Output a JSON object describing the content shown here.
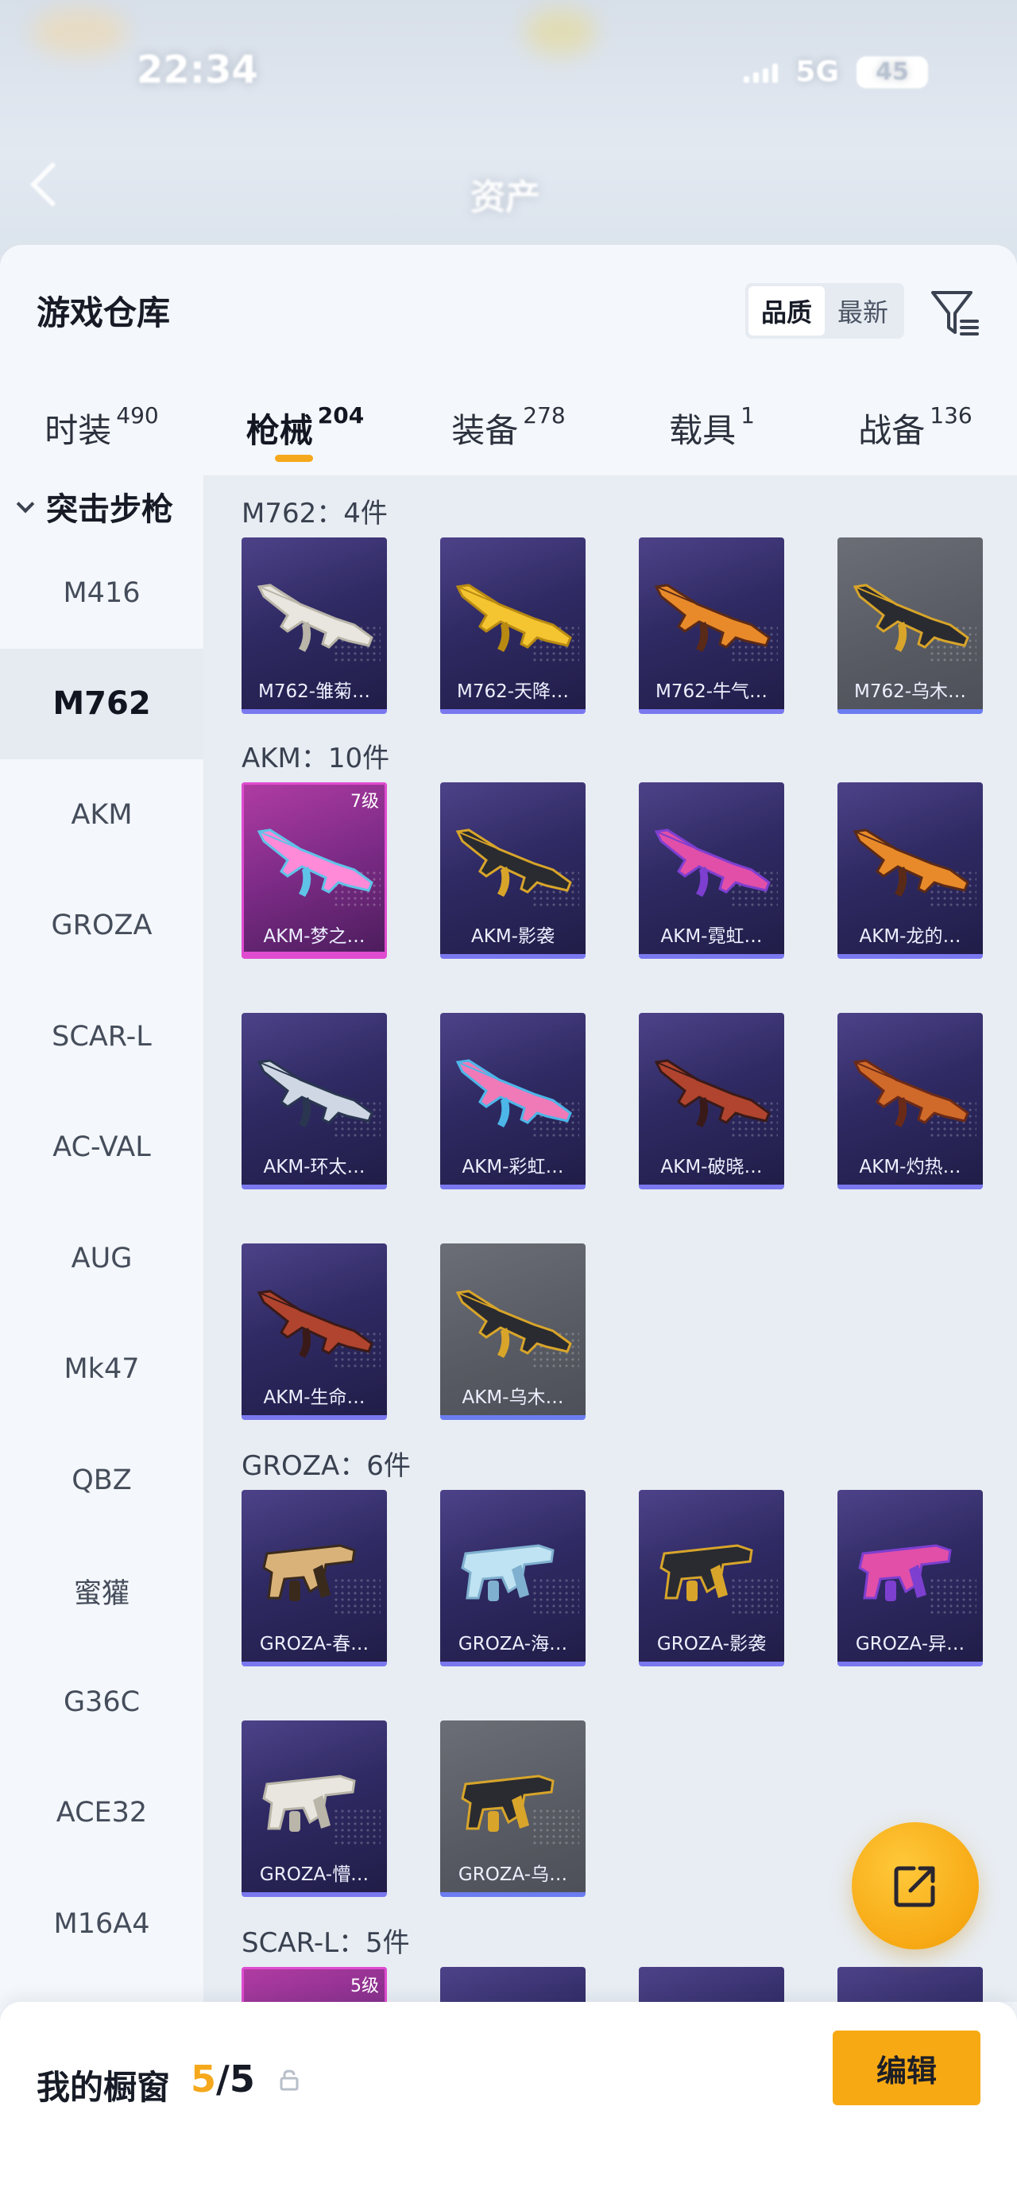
{
  "status_bar": {
    "time": "22:34",
    "network": "5G",
    "battery": "45"
  },
  "background": {
    "title": "资产"
  },
  "warehouse": {
    "title": "游戏仓库",
    "sort_options": [
      "品质",
      "最新"
    ],
    "filter_icon": "filter-icon"
  },
  "tabs": [
    {
      "label": "时装",
      "count": "490"
    },
    {
      "label": "枪械",
      "count": "204",
      "active": true
    },
    {
      "label": "装备",
      "count": "278"
    },
    {
      "label": "载具",
      "count": "1"
    },
    {
      "label": "战备",
      "count": "136"
    }
  ],
  "sidebar": {
    "category": "突击步枪",
    "items": [
      "M416",
      "M762",
      "AKM",
      "GROZA",
      "SCAR-L",
      "AC-VAL",
      "AUG",
      "Mk47",
      "QBZ",
      "蜜獾",
      "G36C",
      "ACE32",
      "M16A4"
    ],
    "active": "M762"
  },
  "sections": [
    {
      "title": "M762：4件",
      "items": [
        {
          "name": "M762-雏菊…",
          "style": "purple",
          "gun": "white"
        },
        {
          "name": "M762-天降…",
          "style": "purple",
          "gun": "gold"
        },
        {
          "name": "M762-牛气…",
          "style": "purple",
          "gun": "orange"
        },
        {
          "name": "M762-乌木…",
          "style": "grey",
          "gun": "black"
        }
      ]
    },
    {
      "title": "AKM：10件",
      "items": [
        {
          "name": "AKM-梦之…",
          "style": "pink",
          "level": "7级",
          "gun": "pink"
        },
        {
          "name": "AKM-影袭",
          "style": "purple",
          "gun": "black"
        },
        {
          "name": "AKM-霓虹…",
          "style": "purple",
          "gun": "magenta"
        },
        {
          "name": "AKM-龙的…",
          "style": "purple",
          "gun": "orange"
        },
        {
          "name": "AKM-环太…",
          "style": "purple",
          "gun": "steel"
        },
        {
          "name": "AKM-彩虹…",
          "style": "purple",
          "gun": "rainbow"
        },
        {
          "name": "AKM-破晓…",
          "style": "purple",
          "gun": "red"
        },
        {
          "name": "AKM-灼热…",
          "style": "purple",
          "gun": "copper"
        },
        {
          "name": "AKM-生命…",
          "style": "purple",
          "gun": "red"
        },
        {
          "name": "AKM-乌木…",
          "style": "grey",
          "gun": "black"
        }
      ]
    },
    {
      "title": "GROZA：6件",
      "items": [
        {
          "name": "GROZA-春…",
          "style": "purple",
          "gun": "tan"
        },
        {
          "name": "GROZA-海…",
          "style": "purple",
          "gun": "ice"
        },
        {
          "name": "GROZA-影袭",
          "style": "purple",
          "gun": "black"
        },
        {
          "name": "GROZA-异…",
          "style": "purple",
          "gun": "magenta"
        },
        {
          "name": "GROZA-懵…",
          "style": "purple",
          "gun": "white"
        },
        {
          "name": "GROZA-乌…",
          "style": "grey",
          "gun": "black"
        }
      ]
    },
    {
      "title": "SCAR-L：5件",
      "items": [
        {
          "name": "",
          "style": "pink",
          "level": "5级",
          "gun": "none"
        },
        {
          "name": "",
          "style": "purple",
          "gun": "none"
        },
        {
          "name": "",
          "style": "purple",
          "gun": "none"
        },
        {
          "name": "",
          "style": "purple",
          "gun": "none"
        }
      ]
    }
  ],
  "colors": {
    "accent": "#f7a914",
    "card_purple": "#2f2a63",
    "card_grey": "#575a62",
    "card_pink": "#7c2b86",
    "card_underline": "#7a78ef"
  },
  "showcase": {
    "label": "我的橱窗",
    "current": "5",
    "separator": "/",
    "max": "5",
    "lock_icon": "lock-icon",
    "edit_label": "编辑"
  },
  "fab": {
    "icon": "share-icon"
  }
}
